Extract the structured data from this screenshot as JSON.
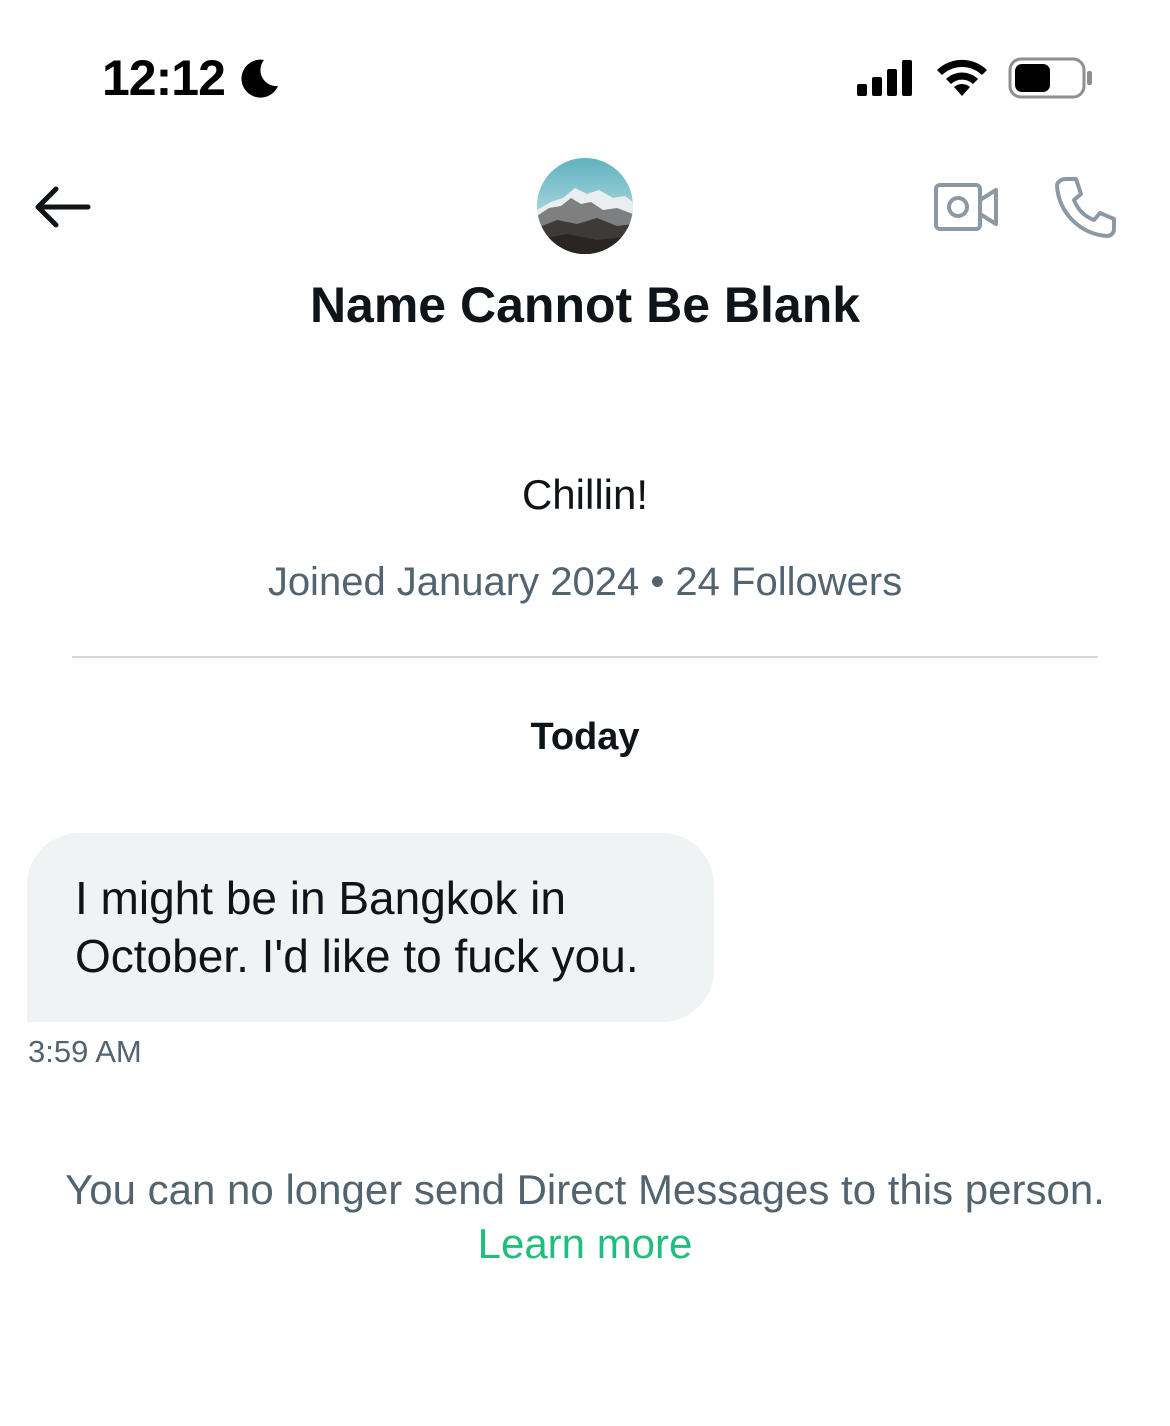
{
  "status_bar": {
    "time": "12:12",
    "focus_icon": "moon-icon",
    "signal_icon": "cellular-signal-icon",
    "wifi_icon": "wifi-icon",
    "battery_icon": "battery-icon",
    "battery_level": 0.55
  },
  "header": {
    "back_icon": "arrow-left-icon",
    "avatar_description": "mountain-avatar",
    "video_call_icon": "video-camera-icon",
    "phone_call_icon": "phone-icon"
  },
  "profile": {
    "name": "Name Cannot Be Blank",
    "bio": "Chillin!",
    "meta": "Joined January 2024 • 24 Followers"
  },
  "conversation": {
    "date_label": "Today",
    "messages": [
      {
        "text": "I might be in Bangkok in October. I'd like to fuck you.",
        "time": "3:59 AM"
      }
    ]
  },
  "notice": {
    "text": "You can no longer send Direct Messages to this person.",
    "link": "Learn more"
  },
  "colors": {
    "text_primary": "#0f1419",
    "text_secondary": "#536471",
    "bubble_bg": "#eff3f4",
    "link": "#1fbe7c",
    "icon_gray": "#8b98a5"
  }
}
